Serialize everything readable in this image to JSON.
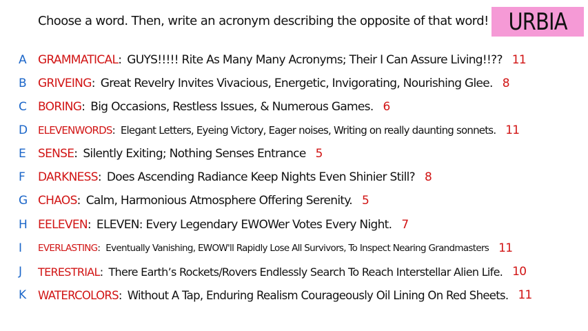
{
  "prompt": "Choose a word. Then, write an acronym describing the opposite of that word!",
  "badge": {
    "label": "URBIA",
    "color": "#f59ad6"
  },
  "colors": {
    "letter": "#1b66c9",
    "word": "#d11414",
    "score": "#d11414",
    "text": "#111111"
  },
  "entries": [
    {
      "letter": "A",
      "word": "GRAMMATICAL",
      "acronym": "GUYS!!!!! Rite As Many Many Acronyms; Their I Can Assure Living!!??",
      "score": "11"
    },
    {
      "letter": "B",
      "word": "GRIVEING",
      "acronym": "Great Revelry Invites Vivacious, Energetic, Invigorating, Nourishing Glee.",
      "score": "8"
    },
    {
      "letter": "C",
      "word": "BORING",
      "acronym": "Big Occasions, Restless Issues, & Numerous Games.",
      "score": "6"
    },
    {
      "letter": "D",
      "word": "ELEVENWORDS",
      "acronym": "Elegant Letters, Eyeing Victory, Eager noises, Writing on really daunting sonnets.",
      "score": "11"
    },
    {
      "letter": "E",
      "word": "SENSE",
      "acronym": "Silently Exiting; Nothing Senses Entrance",
      "score": "5"
    },
    {
      "letter": "F",
      "word": "DARKNESS",
      "acronym": "Does Ascending Radiance Keep Nights Even Shinier Still?",
      "score": "8"
    },
    {
      "letter": "G",
      "word": "CHAOS",
      "acronym": "Calm, Harmonious Atmosphere Offering Serenity.",
      "score": "5"
    },
    {
      "letter": "H",
      "word": "EELEVEN",
      "acronym": "ELEVEN: Every Legendary EWOWer Votes Every Night.",
      "score": "7"
    },
    {
      "letter": "I",
      "word": "EVERLASTING",
      "acronym": "Eventually Vanishing, EWOW'll Rapidly Lose All Survivors, To Inspect Nearing Grandmasters",
      "score": "11"
    },
    {
      "letter": "J",
      "word": "TERESTRIAL",
      "acronym": "There Earth’s Rockets/Rovers Endlessly Search To Reach Interstellar Alien Life.",
      "score": "10"
    },
    {
      "letter": "K",
      "word": "WATERCOLORS",
      "acronym": "Without A Tap, Enduring Realism Courageously Oil Lining On Red Sheets.",
      "score": "11"
    }
  ]
}
